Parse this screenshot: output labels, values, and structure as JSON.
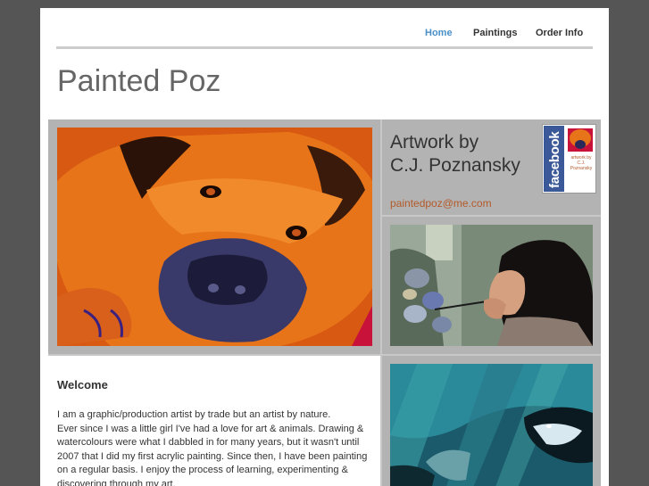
{
  "nav": {
    "items": [
      {
        "label": "Home",
        "active": true
      },
      {
        "label": "Paintings",
        "active": false
      },
      {
        "label": "Order Info",
        "active": false
      }
    ]
  },
  "site": {
    "title": "Painted Poz"
  },
  "artist": {
    "title_line1": "Artwork by",
    "title_line2": "C.J. Poznansky",
    "email": "paintedpoz@me.com"
  },
  "facebook_badge": {
    "label": "facebook",
    "caption_line1": "artwork by",
    "caption_line2": "C.J.",
    "caption_line3": "Poznansky"
  },
  "welcome": {
    "heading": "Welcome",
    "paragraphs": [
      "I am a graphic/production artist by trade but an artist by nature.",
      "Ever since I was a little girl I've had a love for art & animals. Drawing & watercolours were what I dabbled in for many years, but it wasn't until 2007 that I did my first acrylic painting. Since then, I have been painting on a regular basis. I enjoy the process of learning, experimenting & discovering through my art."
    ]
  },
  "images": {
    "main": "dog-painting",
    "studio": "artist-painting-photo",
    "orca": "orca-painting"
  },
  "colors": {
    "page_bg": "#555555",
    "nav_active": "#4a90c8",
    "email": "#b35a2a",
    "facebook": "#3b5998"
  }
}
